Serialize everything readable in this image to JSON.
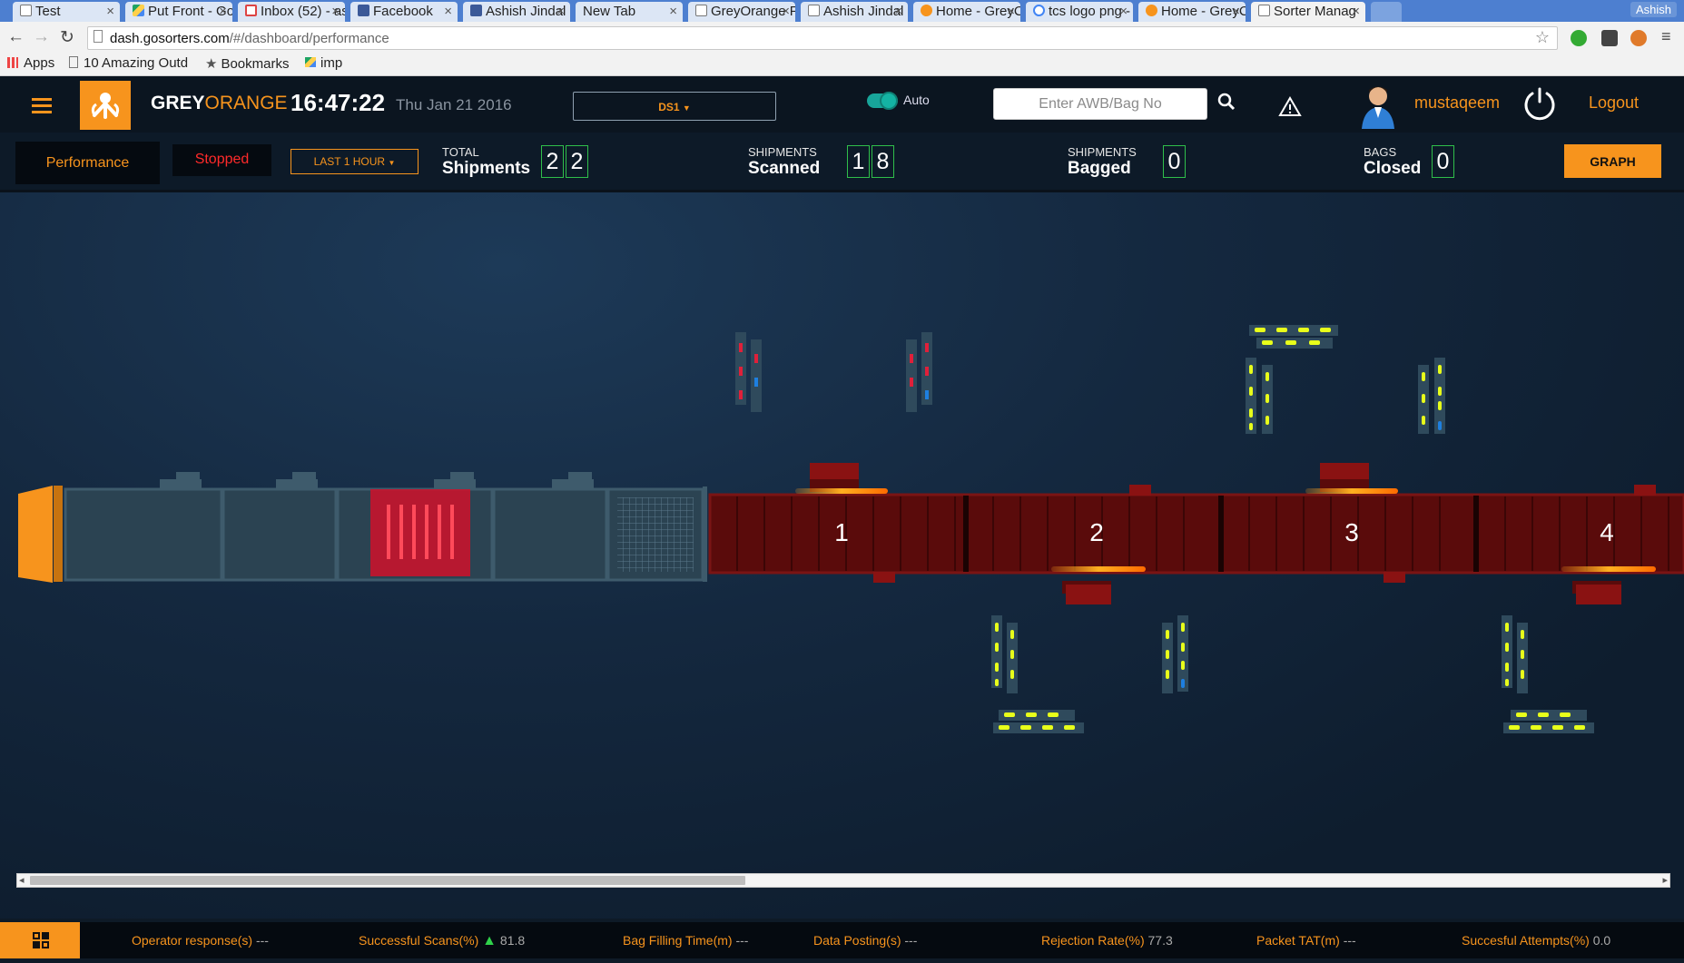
{
  "browser": {
    "tabs": [
      {
        "title": "Test",
        "favicon": "doc-icon",
        "active": false
      },
      {
        "title": "Put Front - Go",
        "favicon": "drive-icon",
        "active": false
      },
      {
        "title": "Inbox (52) - as",
        "favicon": "gmail-icon",
        "active": false
      },
      {
        "title": "Facebook",
        "favicon": "facebook-icon",
        "active": false
      },
      {
        "title": "Ashish Jindal",
        "favicon": "facebook-icon",
        "active": false
      },
      {
        "title": "New Tab",
        "favicon": "none",
        "active": false
      },
      {
        "title": "GreyOrange F",
        "favicon": "doc-icon",
        "active": false
      },
      {
        "title": "Ashish Jindal",
        "favicon": "doc-icon",
        "active": false
      },
      {
        "title": "Home - GreyC",
        "favicon": "greyorange-icon",
        "active": false
      },
      {
        "title": "tcs logo png -",
        "favicon": "google-icon",
        "active": false
      },
      {
        "title": "Home - GreyC",
        "favicon": "greyorange-icon",
        "active": false
      },
      {
        "title": "Sorter Manag",
        "favicon": "doc-icon",
        "active": true
      }
    ],
    "profile_name": "Ashish",
    "url_host": "dash.gosorters.com",
    "url_path": "/#/dashboard/performance",
    "bookmarks": [
      "Apps",
      "10 Amazing Outd",
      "Bookmarks",
      "imp"
    ]
  },
  "header": {
    "brand_grey": "GREY",
    "brand_orange": "ORANGE",
    "time": "16:47:22",
    "date": "Thu Jan 21 2016",
    "sorter_select": "DS1",
    "mode_label": "Auto",
    "search_placeholder": "Enter AWB/Bag No",
    "username": "mustaqeem",
    "logout_label": "Logout"
  },
  "stats": {
    "performance_tab": "Performance",
    "status": "Stopped",
    "range": "LAST 1 HOUR",
    "total_small": "TOTAL",
    "total_big": "Shipments",
    "total_digits": [
      "2",
      "2"
    ],
    "scanned_small": "SHIPMENTS",
    "scanned_big": "Scanned",
    "scanned_digits": [
      "1",
      "8"
    ],
    "bagged_small": "SHIPMENTS",
    "bagged_big": "Bagged",
    "bagged_digits": [
      "0"
    ],
    "closed_small": "BAGS",
    "closed_big": "Closed",
    "closed_digits": [
      "0"
    ],
    "graph_label": "GRAPH"
  },
  "sorter": {
    "sections": [
      "1",
      "2",
      "3",
      "4"
    ]
  },
  "footer": {
    "kpis": [
      {
        "label": "Operator response(s)",
        "value": "---",
        "trend": ""
      },
      {
        "label": "Successful Scans(%)",
        "value": "81.8",
        "trend": "up"
      },
      {
        "label": "Bag Filling Time(m)",
        "value": "---",
        "trend": ""
      },
      {
        "label": "Data Posting(s)",
        "value": "---",
        "trend": ""
      },
      {
        "label": "Rejection Rate(%)",
        "value": "77.3",
        "trend": ""
      },
      {
        "label": "Packet TAT(m)",
        "value": "---",
        "trend": ""
      },
      {
        "label": "Succesful Attempts(%)",
        "value": "0.0",
        "trend": ""
      }
    ]
  },
  "colors": {
    "accent": "#f7941d",
    "status_stopped": "#ff2a2a",
    "digit_border": "#2fbf4a",
    "conveyor": "#6a0e0e",
    "bin_yellow": "#e8ff1a",
    "bin_red": "#e0203a",
    "bin_blue": "#1e7fe0"
  }
}
